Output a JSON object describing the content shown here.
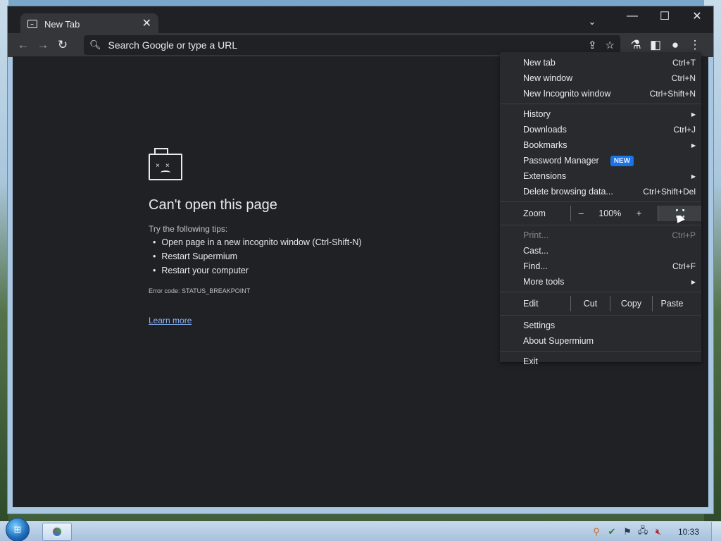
{
  "tab": {
    "title": "New Tab"
  },
  "window_controls": {
    "minimize": "—",
    "maximize": "☐",
    "close": "✕"
  },
  "omnibox": {
    "placeholder": "Search Google or type a URL"
  },
  "error_page": {
    "title": "Can't open this page",
    "tips_heading": "Try the following tips:",
    "tips": [
      "Open page in a new incognito window (Ctrl-Shift-N)",
      "Restart Supermium",
      "Restart your computer"
    ],
    "error_code": "Error code: STATUS_BREAKPOINT",
    "learn_more": "Learn more"
  },
  "menu": {
    "new_tab": {
      "label": "New tab",
      "shortcut": "Ctrl+T"
    },
    "new_window": {
      "label": "New window",
      "shortcut": "Ctrl+N"
    },
    "new_incognito": {
      "label": "New Incognito window",
      "shortcut": "Ctrl+Shift+N"
    },
    "history": {
      "label": "History"
    },
    "downloads": {
      "label": "Downloads",
      "shortcut": "Ctrl+J"
    },
    "bookmarks": {
      "label": "Bookmarks"
    },
    "password_manager": {
      "label": "Password Manager",
      "badge": "NEW"
    },
    "extensions": {
      "label": "Extensions"
    },
    "delete_browsing": {
      "label": "Delete browsing data...",
      "shortcut": "Ctrl+Shift+Del"
    },
    "zoom": {
      "label": "Zoom",
      "minus": "–",
      "value": "100%",
      "plus": "+"
    },
    "print": {
      "label": "Print...",
      "shortcut": "Ctrl+P"
    },
    "cast": {
      "label": "Cast..."
    },
    "find": {
      "label": "Find...",
      "shortcut": "Ctrl+F"
    },
    "more_tools": {
      "label": "More tools"
    },
    "edit": {
      "label": "Edit",
      "cut": "Cut",
      "copy": "Copy",
      "paste": "Paste"
    },
    "settings": {
      "label": "Settings"
    },
    "about": {
      "label": "About Supermium"
    },
    "exit": {
      "label": "Exit"
    }
  },
  "taskbar": {
    "clock": "10:33"
  },
  "colors": {
    "menu_bg": "#292a2d",
    "page_bg": "#202124",
    "link": "#8ab4f8",
    "badge": "#1a73e8"
  }
}
